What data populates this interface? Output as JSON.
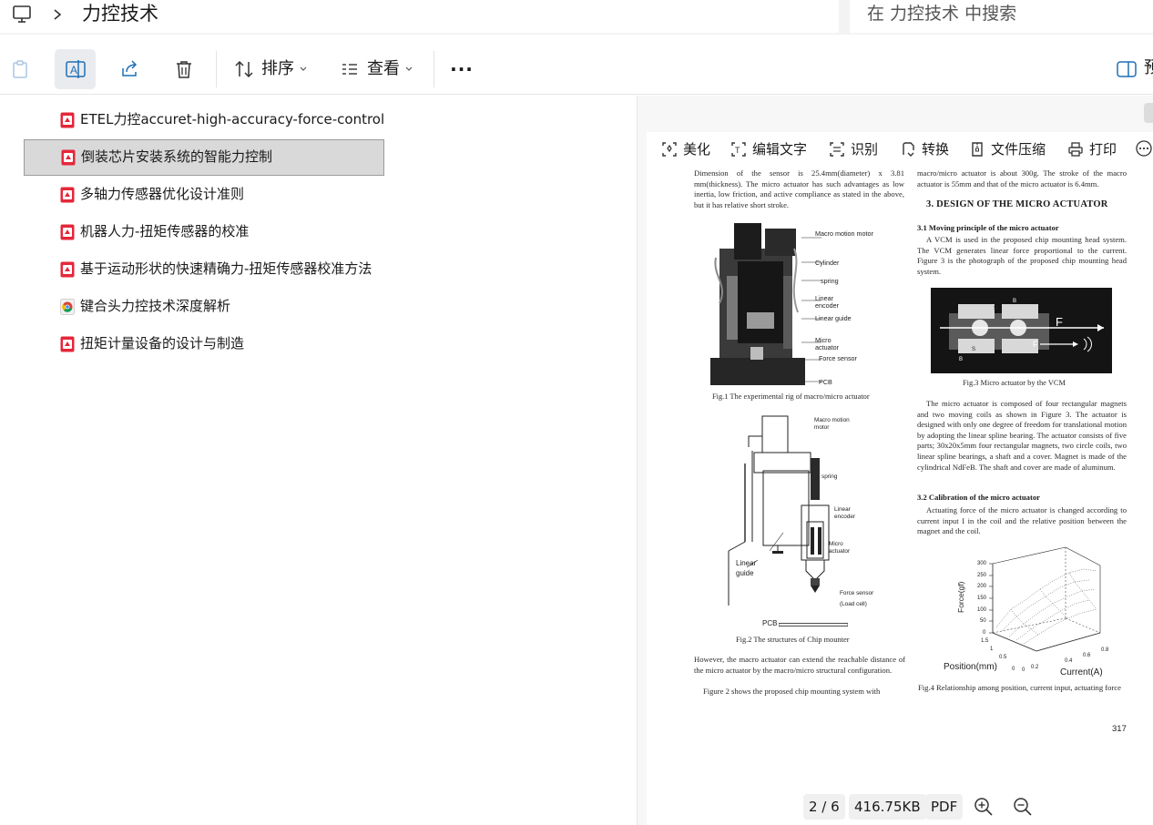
{
  "address_bar": {
    "breadcrumb": "力控技术",
    "search_placeholder": "在 力控技术 中搜索"
  },
  "toolbar": {
    "sort_label": "排序",
    "view_label": "查看",
    "more_label": "···",
    "preview_label": "预"
  },
  "files": [
    {
      "name": "ETEL力控accuret-high-accuracy-force-control",
      "type": "pdf",
      "icon": "pdf-icon"
    },
    {
      "name": "倒装芯片安装系统的智能力控制",
      "type": "pdf",
      "icon": "pdf-icon",
      "selected": true
    },
    {
      "name": "多轴力传感器优化设计准则",
      "type": "pdf",
      "icon": "pdf-icon"
    },
    {
      "name": "机器人力-扭矩传感器的校准",
      "type": "pdf",
      "icon": "pdf-icon"
    },
    {
      "name": "基于运动形状的快速精确力-扭矩传感器校准方法",
      "type": "pdf",
      "icon": "pdf-icon"
    },
    {
      "name": "键合头力控技术深度解析",
      "type": "html",
      "icon": "chrome-icon"
    },
    {
      "name": "扭矩计量设备的设计与制造",
      "type": "pdf",
      "icon": "pdf-icon"
    }
  ],
  "preview": {
    "tools": [
      "美化",
      "编辑文字",
      "识别",
      "转换",
      "文件压缩",
      "打印"
    ],
    "status": {
      "page": "2 / 6",
      "size": "416.75KB",
      "format": "PDF"
    },
    "document": {
      "left_intro": "Dimension of the sensor is 25.4mm(diameter) x 3.81 mm(thickness). The micro actuator has such advantages as low inertia, low friction, and active compliance as stated in the above, but it has relative short stroke.",
      "fig1_labels": [
        "Macro motion motor",
        "Cylinder",
        "spring",
        "Linear encoder",
        "Linear guide",
        "Micro actuator",
        "Force sensor",
        "PCB"
      ],
      "fig1_caption": "Fig.1 The experimental rig of macro/micro actuator",
      "fig2_labels": [
        "Macro motion motor",
        "spring",
        "Linear encoder",
        "Micro actuator",
        "Linear guide",
        "Force sensor (Load cell)",
        "PCB"
      ],
      "fig2_caption": "Fig.2 The structures of Chip mounter",
      "left_after": "However, the macro actuator can extend the reachable distance of the micro actuator by the macro/micro structural configuration.",
      "left_after2": "Figure 2 shows the proposed chip mounting system with",
      "right_intro": "macro/micro actuator is about 300g. The stroke of the macro actuator is 55mm and that of the micro actuator is 6.4mm.",
      "section_title": "3. DESIGN OF THE MICRO ACTUATOR",
      "sub1": "3.1 Moving principle of the micro actuator",
      "sub1_text": "A VCM is used in the proposed chip mounting head system. The VCM generates linear force proportional to the current. Figure 3 is the photograph of the proposed chip mounting head system.",
      "fig3_caption": "Fig.3 Micro actuator by the VCM",
      "fig3_text": "The micro actuator is composed of four rectangular magnets and two moving coils as shown in Figure 3. The actuator is designed with only one degree of freedom for translational motion by adopting the linear spline bearing. The actuator consists of five parts; 30x20x5mm four rectangular magnets, two circle coils, two linear spline bearings, a shaft and a cover. Magnet is made of the cylindrical NdFeB. The shaft and cover are made of aluminum.",
      "sub2": "3.2 Calibration of the micro actuator",
      "sub2_text": "Actuating force of the micro actuator is changed according to current input I in the coil and the relative position between the magnet and the coil.",
      "fig4_axis_z": "Force(gf)",
      "fig4_axis_x": "Position(mm)",
      "fig4_axis_y": "Current(A)",
      "fig4_z_ticks": [
        "300",
        "250",
        "200",
        "150",
        "100",
        "50",
        "0"
      ],
      "fig4_x_ticks": [
        "1.5",
        "1",
        "0.5",
        "0"
      ],
      "fig4_y_ticks": [
        "0",
        "0.2",
        "0.4",
        "0.6",
        "0.8"
      ],
      "fig4_caption": "Fig.4 Relationship among position, current input, actuating force",
      "page_number": "317",
      "fig3_letters": [
        "F",
        "F",
        "S",
        "B",
        "S",
        "B"
      ]
    }
  }
}
